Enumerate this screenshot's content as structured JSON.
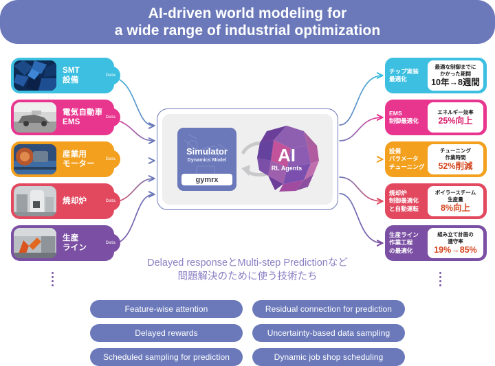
{
  "header": {
    "title": "AI-driven world modeling for\na wide range of industrial optimization",
    "bg": "#6b79ba"
  },
  "left_column": {
    "data_badge_label": "Data",
    "cards": [
      {
        "label": "SMT\n設備",
        "color": "#3cbfe0",
        "thumb_name": "smt-equipment-photo",
        "badge": "Data"
      },
      {
        "label": "電気自動車\nEMS",
        "color": "#e8368f",
        "thumb_name": "electric-vehicle-photo",
        "badge": "Data"
      },
      {
        "label": "産業用\nモーター",
        "color": "#f2a01e",
        "thumb_name": "industrial-motor-photo",
        "badge": "Data"
      },
      {
        "label": "焼却炉",
        "color": "#e2495f",
        "thumb_name": "incinerator-photo",
        "badge": "Data"
      },
      {
        "label": "生産\nライン",
        "color": "#7b4fa3",
        "thumb_name": "production-line-photo",
        "badge": "Data"
      }
    ],
    "ellipsis": "⋮"
  },
  "center": {
    "simulator_title": "Simulator",
    "simulator_subtitle": "Dynamics Model",
    "simulator_chip": "gymrx",
    "ai_title": "AI",
    "ai_subtitle": "RL Agents",
    "border_color": "#6b79ba",
    "inner_bg": "#efeff0"
  },
  "right_column": {
    "cards": [
      {
        "label": "チップ実装\n最適化",
        "color": "#3cbfe0",
        "caption": "最適な制御までに\nかかった期間",
        "value": "10年→8週間",
        "value_color": "#1c1c1c"
      },
      {
        "label": "EMS\n制御最適化",
        "color": "#e8368f",
        "caption": "エネルギー効率",
        "value": "25%向上",
        "value_color": "#d81e6a"
      },
      {
        "label": "設備\nパラメータ\nチューニング",
        "color": "#f2a01e",
        "caption": "チューニング\n作業時間",
        "value": "52%削減",
        "value_color": "#d4451f"
      },
      {
        "label": "焼却炉\n制御最適化\nと自動運転",
        "color": "#e2495f",
        "caption": "ボイラースチーム\n生産量",
        "value": "8%向上",
        "value_color": "#d4451f"
      },
      {
        "label": "生産ライン\n作業工程\nの最適化",
        "color": "#7b4fa3",
        "caption": "組み立て計画の\n遵守率",
        "value": "19%→85%",
        "value_color": "#d4451f"
      }
    ],
    "ellipsis": "⋮"
  },
  "caption": "Delayed responseとMulti-step Predictionなど\n問題解決のために使う技術たち",
  "bottom_pills": {
    "left": [
      "Feature-wise attention",
      "Delayed rewards",
      "Scheduled sampling for prediction"
    ],
    "right": [
      "Residual connection for prediction",
      "Uncertainty-based data sampling",
      "Dynamic job shop scheduling"
    ],
    "color": "#6b79ba"
  }
}
